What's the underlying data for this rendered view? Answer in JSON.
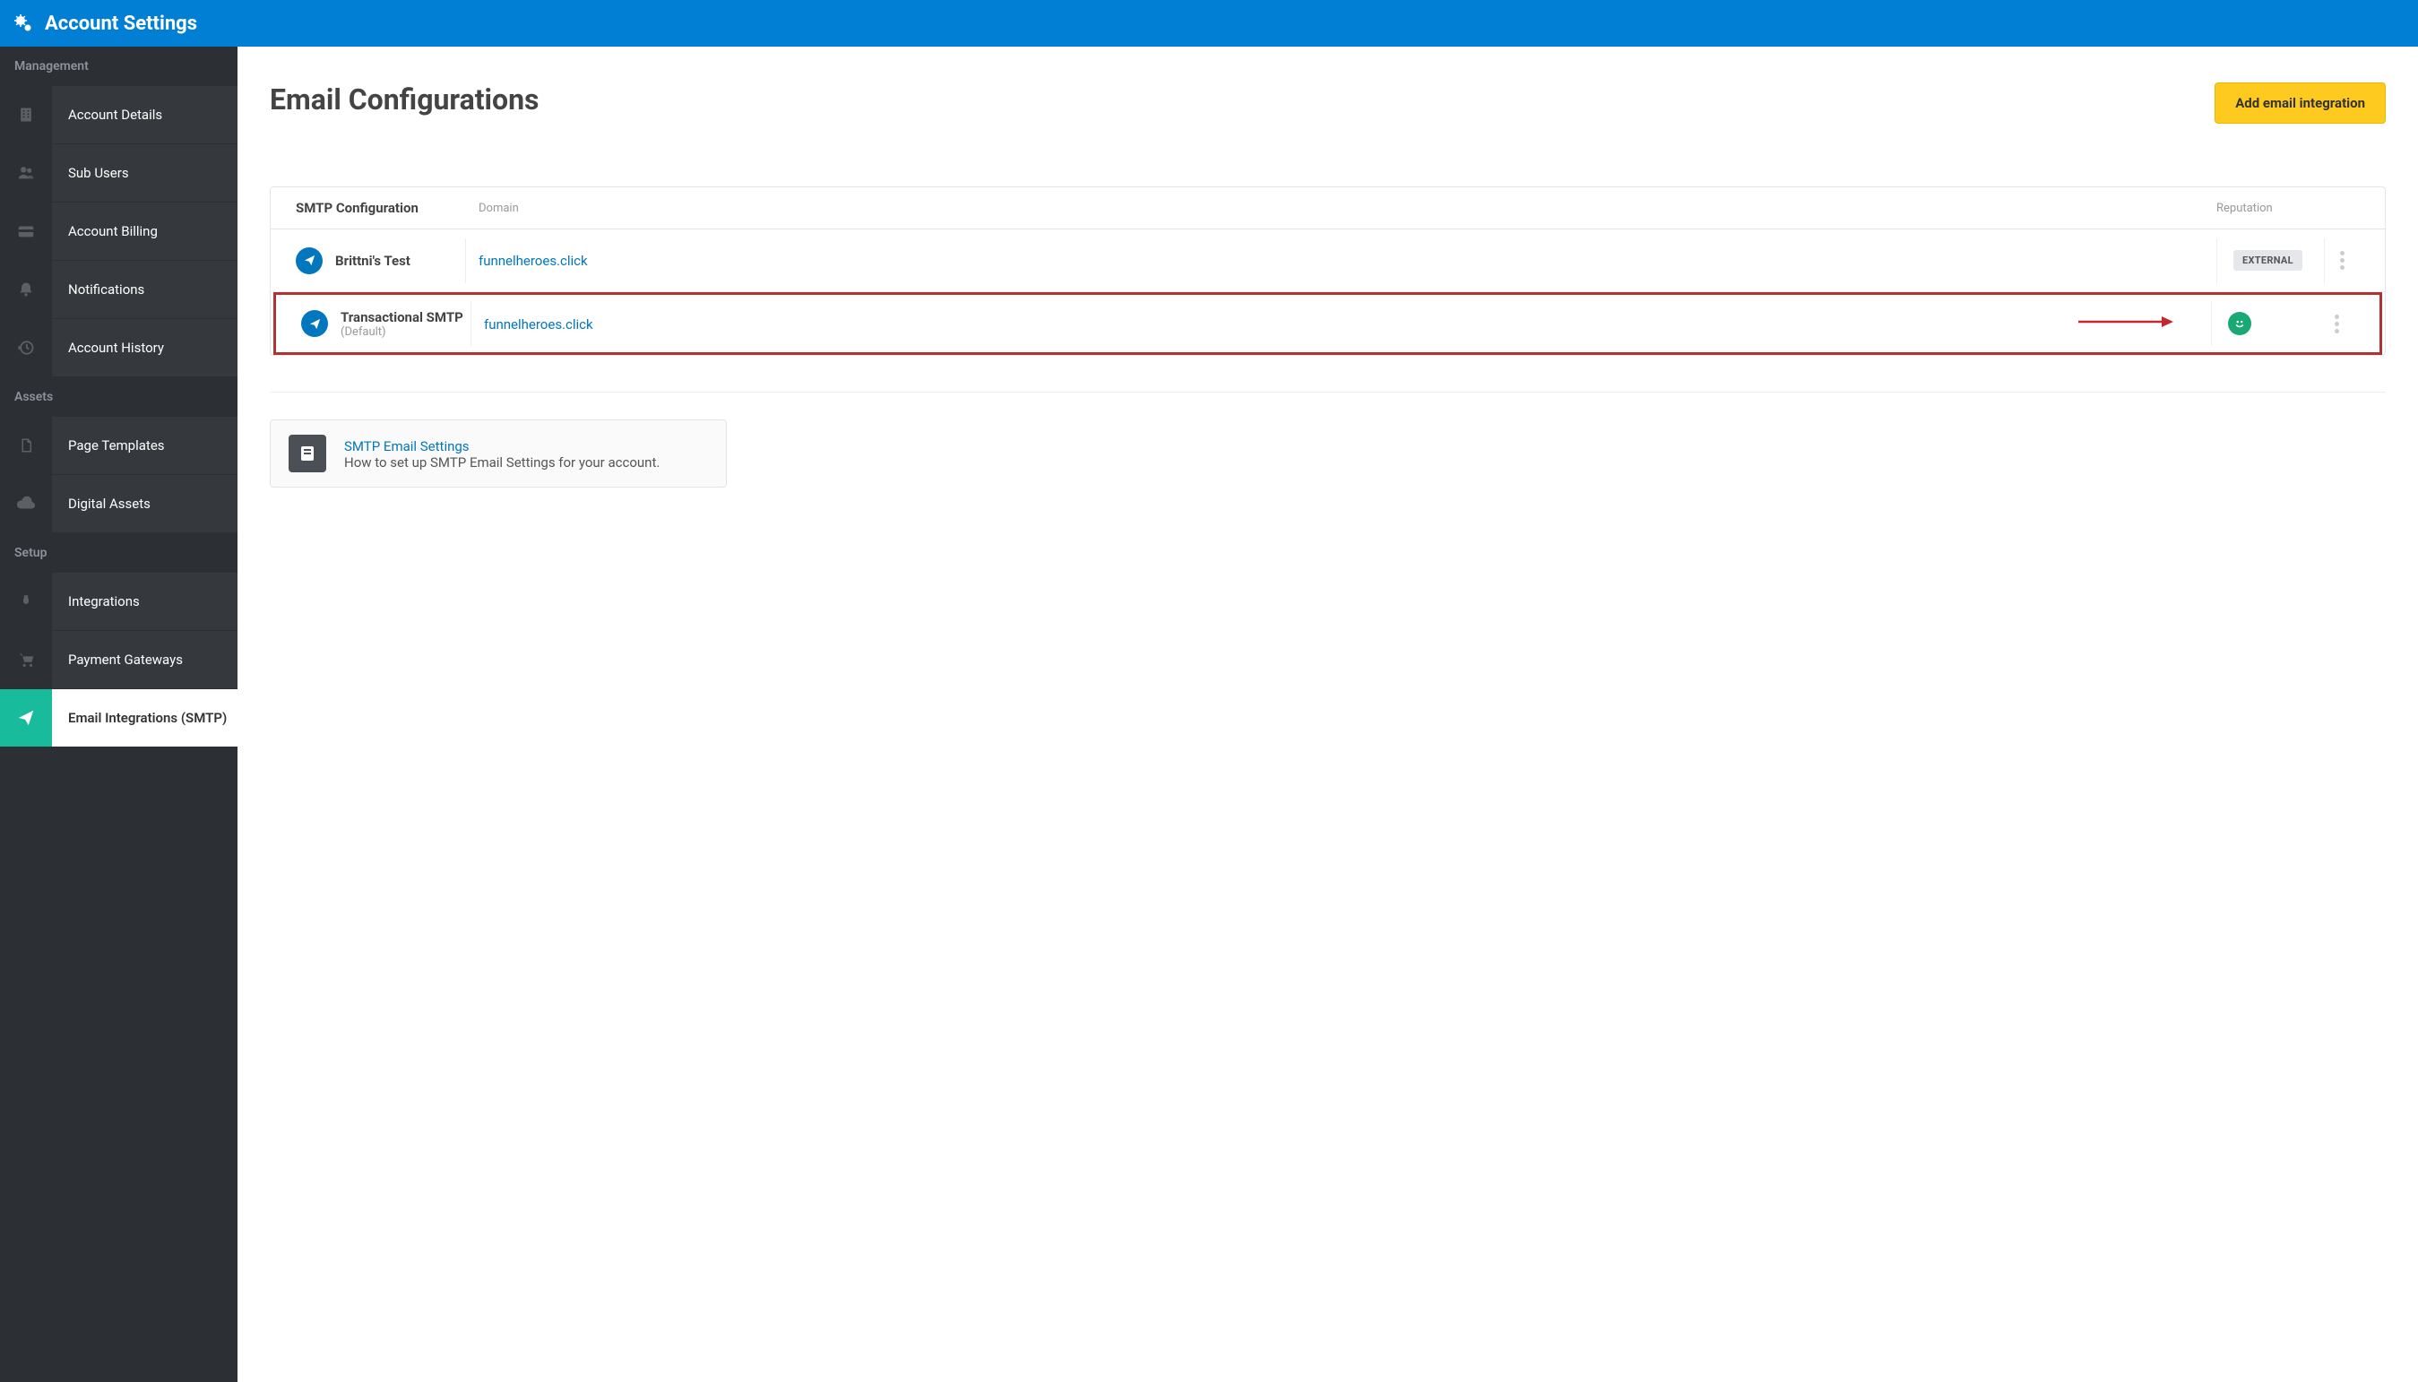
{
  "header": {
    "title": "Account Settings"
  },
  "sidebar": {
    "sections": [
      {
        "label": "Management",
        "items": [
          {
            "label": "Account Details",
            "icon": "building-icon"
          },
          {
            "label": "Sub Users",
            "icon": "users-icon"
          },
          {
            "label": "Account Billing",
            "icon": "card-icon"
          },
          {
            "label": "Notifications",
            "icon": "bell-icon"
          },
          {
            "label": "Account History",
            "icon": "history-icon"
          }
        ]
      },
      {
        "label": "Assets",
        "items": [
          {
            "label": "Page Templates",
            "icon": "file-icon"
          },
          {
            "label": "Digital Assets",
            "icon": "cloud-icon"
          }
        ]
      },
      {
        "label": "Setup",
        "items": [
          {
            "label": "Integrations",
            "icon": "plug-icon"
          },
          {
            "label": "Payment Gateways",
            "icon": "cart-icon"
          },
          {
            "label": "Email Integrations (SMTP)",
            "icon": "send-icon",
            "active": true
          }
        ]
      }
    ]
  },
  "main": {
    "title": "Email Configurations",
    "add_button": "Add email integration",
    "table": {
      "col_name": "SMTP Configuration",
      "col_domain": "Domain",
      "col_reputation": "Reputation",
      "rows": [
        {
          "name": "Brittni's Test",
          "sub": "",
          "domain": "funnelheroes.click",
          "reputation_badge": "EXTERNAL",
          "highlighted": false
        },
        {
          "name": "Transactional SMTP",
          "sub": "(Default)",
          "domain": "funnelheroes.click",
          "reputation_smiley": true,
          "highlighted": true
        }
      ]
    },
    "help": {
      "link": "SMTP Email Settings",
      "desc": "How to set up SMTP Email Settings for your account."
    }
  },
  "colors": {
    "brand": "#007fd5",
    "accent": "#ffca1f",
    "active_green": "#18bb9b",
    "link": "#0277bd",
    "highlight_border": "#b13232"
  }
}
